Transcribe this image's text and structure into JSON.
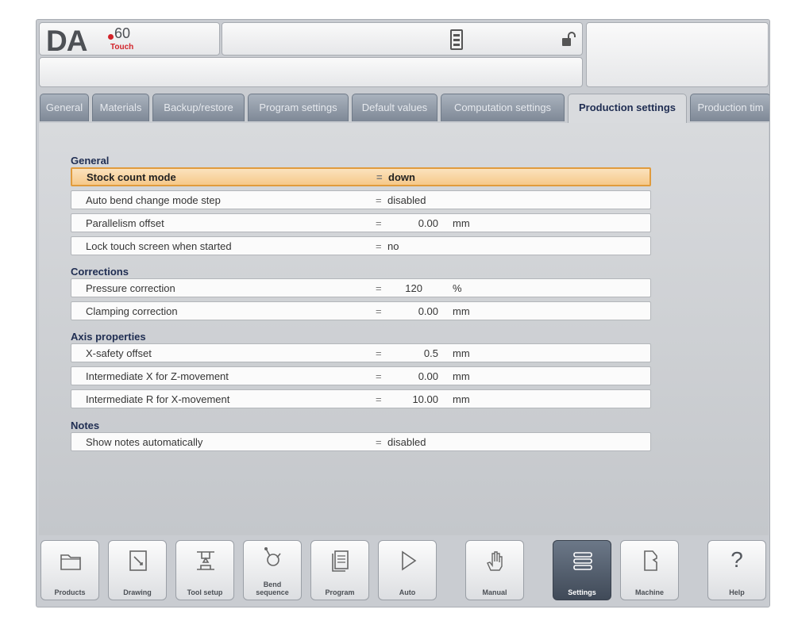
{
  "app": {
    "brand": "DA",
    "model": "60",
    "variant": "Touch"
  },
  "tabs": [
    {
      "label": "General"
    },
    {
      "label": "Materials"
    },
    {
      "label": "Backup/restore"
    },
    {
      "label": "Program settings"
    },
    {
      "label": "Default values"
    },
    {
      "label": "Computation settings"
    },
    {
      "label": "Production settings",
      "active": true
    },
    {
      "label": "Production tim"
    }
  ],
  "sections": {
    "general": {
      "title": "General",
      "rows": [
        {
          "label": "Stock count mode",
          "eq": "=",
          "value": "down",
          "selected": true
        },
        {
          "label": "Auto bend change mode step",
          "eq": "=",
          "value": "disabled"
        },
        {
          "label": "Parallelism offset",
          "eq": "=",
          "value": "0.00",
          "unit": "mm"
        },
        {
          "label": "Lock touch screen when started",
          "eq": "=",
          "value": "no"
        }
      ]
    },
    "corrections": {
      "title": "Corrections",
      "rows": [
        {
          "label": "Pressure correction",
          "eq": "=",
          "value": "120",
          "unit": "%"
        },
        {
          "label": "Clamping correction",
          "eq": "=",
          "value": "0.00",
          "unit": "mm"
        }
      ]
    },
    "axis": {
      "title": "Axis properties",
      "rows": [
        {
          "label": "X-safety offset",
          "eq": "=",
          "value": "0.5",
          "unit": "mm"
        },
        {
          "label": "Intermediate X for Z-movement",
          "eq": "=",
          "value": "0.00",
          "unit": "mm"
        },
        {
          "label": "Intermediate R for X-movement",
          "eq": "=",
          "value": "10.00",
          "unit": "mm"
        }
      ]
    },
    "notes": {
      "title": "Notes",
      "rows": [
        {
          "label": "Show notes automatically",
          "eq": "=",
          "value": "disabled"
        }
      ]
    }
  },
  "bottom": {
    "products": {
      "label": "Products",
      "icon": "folder-icon"
    },
    "drawing": {
      "label": "Drawing",
      "icon": "drawing-icon"
    },
    "tool_setup": {
      "label": "Tool setup",
      "icon": "tool-setup-icon"
    },
    "bend_sequence": {
      "label_line1": "Bend",
      "label_line2": "sequence",
      "icon": "bend-sequence-icon"
    },
    "program": {
      "label": "Program",
      "icon": "program-icon"
    },
    "auto": {
      "label": "Auto",
      "icon": "play-icon"
    },
    "manual": {
      "label": "Manual",
      "icon": "hand-icon"
    },
    "settings": {
      "label": "Settings",
      "icon": "settings-list-icon",
      "active": true
    },
    "machine": {
      "label": "Machine",
      "icon": "machine-icon"
    },
    "help": {
      "label": "Help",
      "symbol": "?"
    }
  },
  "colors": {
    "selected_row_fill": "#f6c98a",
    "selected_row_border": "#e09b3d",
    "section_title": "#1f2d52",
    "active_button": "#4a5564",
    "brand_red": "#d2232a"
  }
}
